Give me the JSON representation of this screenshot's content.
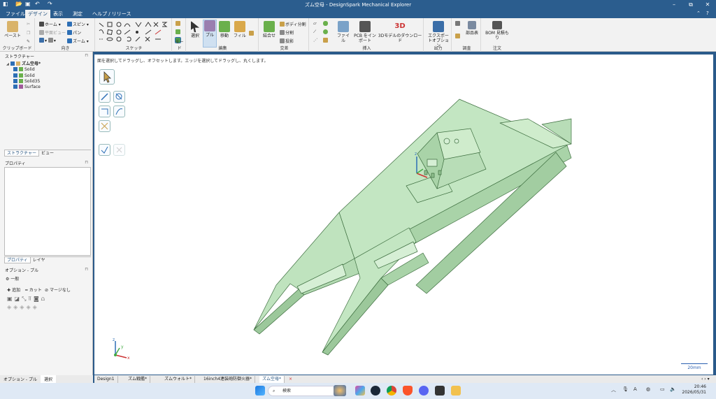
{
  "titlebar": {
    "title": "ズム空母 - DesignSpark Mechanical Explorer",
    "minimize": "–",
    "restore": "⧉",
    "close": "✕"
  },
  "menu": {
    "tabs": [
      "ファイル",
      "デザイン",
      "表示",
      "測定",
      "ヘルプ / リリース"
    ],
    "active": 1,
    "help": "?"
  },
  "ribbon": {
    "clipboard": {
      "label": "クリップボード",
      "paste": "ペースト"
    },
    "orient": {
      "label": "向き",
      "home": "ホーム",
      "plane": "平面ビュー",
      "spin": "スピン",
      "pan": "パン",
      "zoom": "ズーム"
    },
    "sketch": {
      "label": "スケッチ"
    },
    "mode": {
      "label": "モード"
    },
    "edit": {
      "label": "編集",
      "select": "選択",
      "pull": "プル",
      "move": "移動",
      "fill": "フィル"
    },
    "intersect": {
      "label": "交差",
      "combine": "結合せ",
      "split_body": "ボディ分割",
      "split": "分割",
      "project": "投影"
    },
    "insert": {
      "label": "挿入",
      "file": "ファイル",
      "pcb": "PCB をインポート",
      "models": "3Dモデルのダウンロード"
    },
    "output": {
      "label": "出力",
      "export": "エクスポートオプション"
    },
    "inspect": {
      "label": "調査",
      "parts": "部品表"
    },
    "order": {
      "label": "注文",
      "bom": "BOM 見積もり"
    }
  },
  "structure": {
    "title": "ストラクチャー",
    "root": "ズム空母*",
    "items": [
      "Solid",
      "Solid",
      "Solid35",
      "Surface"
    ]
  },
  "panel_tabs": {
    "a": "ストラクチャー",
    "b": "ビュー"
  },
  "properties": {
    "title": "プロパティ",
    "tab_a": "プロパティ",
    "tab_b": "レイヤ"
  },
  "options": {
    "title": "オプション - プル",
    "general": "一般",
    "add": "追加",
    "cut": "カット",
    "nomerge": "マージなし"
  },
  "canvas": {
    "hint": "面を選択してドラッグし、オフセットします。エッジを選択してドラッグし、丸くします。",
    "scale": "20mm"
  },
  "bottom_left": {
    "a": "オプション - プル",
    "b": "選択"
  },
  "doc_tabs": [
    "Design1",
    "ズム戦艦*",
    "ズムウォルト*",
    "16inch4連装砲防御火器*",
    "ズム空母*"
  ],
  "taskbar": {
    "search": "検索",
    "time": "20:46",
    "date": "2026/05/31"
  },
  "colors": {
    "model": "#c3e6c2",
    "edge": "#3d6e3f",
    "titlebar": "#2b5d8e"
  }
}
